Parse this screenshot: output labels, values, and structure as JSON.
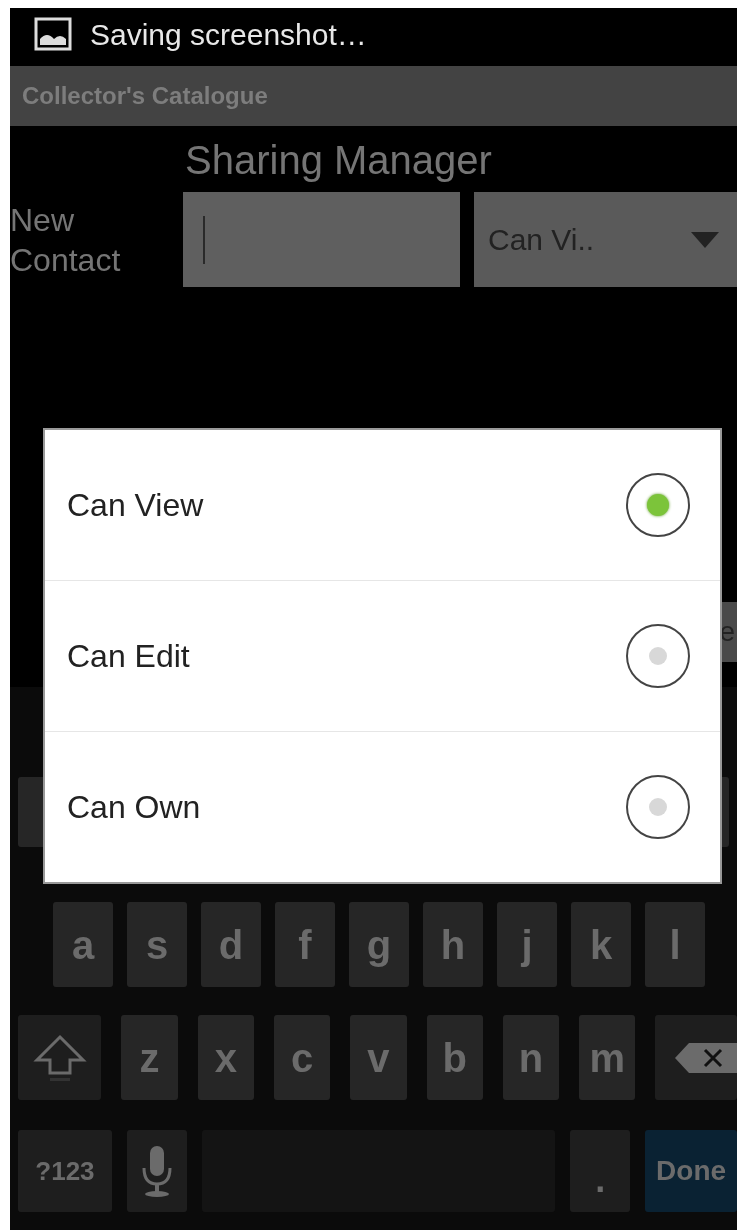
{
  "status_bar": {
    "notification": "Saving screenshot…"
  },
  "app_bar": {
    "title": "Collector's Catalogue"
  },
  "heading": "Sharing Manager",
  "new_contact": {
    "label": "New Contact",
    "permission": "Can Vi.."
  },
  "partial_button": {
    "label": "e"
  },
  "dialog": {
    "options": [
      {
        "label": "Can View",
        "selected": true
      },
      {
        "label": "Can Edit",
        "selected": false
      },
      {
        "label": "Can Own",
        "selected": false
      }
    ]
  },
  "keyboard": {
    "rows": [
      {
        "keys": [
          {
            "kind": "char",
            "label": "a"
          },
          {
            "kind": "char",
            "label": "s"
          },
          {
            "kind": "char",
            "label": "d"
          },
          {
            "kind": "char",
            "label": "f"
          },
          {
            "kind": "char",
            "label": "g"
          },
          {
            "kind": "char",
            "label": "h"
          },
          {
            "kind": "char",
            "label": "j"
          },
          {
            "kind": "char",
            "label": "k"
          },
          {
            "kind": "char",
            "label": "l"
          }
        ]
      },
      {
        "keys": [
          {
            "kind": "shift"
          },
          {
            "kind": "char",
            "label": "z"
          },
          {
            "kind": "char",
            "label": "x"
          },
          {
            "kind": "char",
            "label": "c"
          },
          {
            "kind": "char",
            "label": "v"
          },
          {
            "kind": "char",
            "label": "b"
          },
          {
            "kind": "char",
            "label": "n"
          },
          {
            "kind": "char",
            "label": "m"
          },
          {
            "kind": "backspace"
          }
        ]
      },
      {
        "keys": [
          {
            "kind": "symbols",
            "label": "?123"
          },
          {
            "kind": "mic"
          },
          {
            "kind": "space"
          },
          {
            "kind": "period",
            "label": "."
          },
          {
            "kind": "action",
            "label": "Done"
          }
        ]
      }
    ]
  }
}
